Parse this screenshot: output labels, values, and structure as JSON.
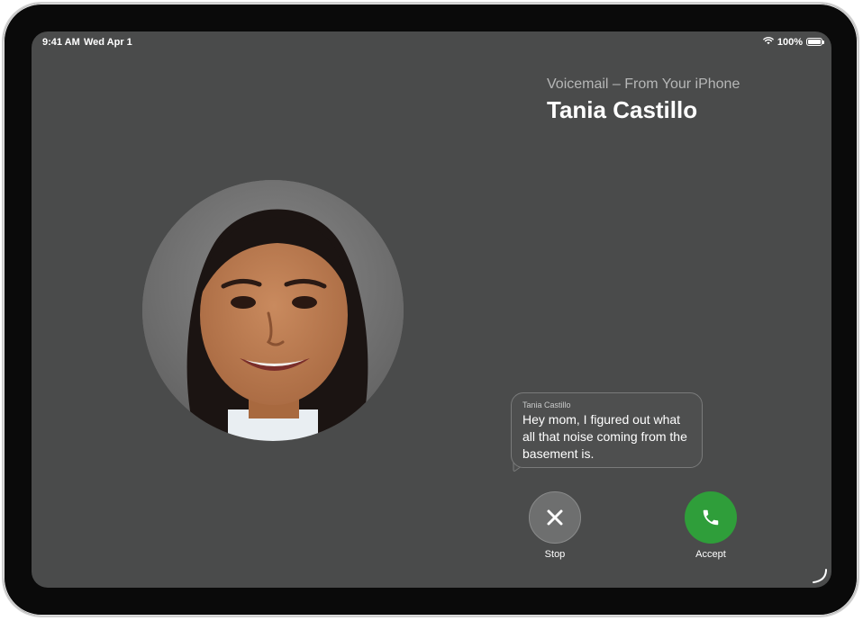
{
  "status_bar": {
    "time": "9:41 AM",
    "date": "Wed Apr 1",
    "battery_percent": "100%",
    "battery_level": 1.0,
    "icons": [
      "wifi-icon",
      "battery-icon"
    ]
  },
  "call": {
    "subtitle": "Voicemail – From Your iPhone",
    "caller_name": "Tania Castillo"
  },
  "transcript": {
    "sender": "Tania Castillo",
    "text": "Hey mom, I figured out what all that noise coming from the basement is."
  },
  "actions": {
    "stop": {
      "label": "Stop",
      "icon": "close-icon"
    },
    "accept": {
      "label": "Accept",
      "icon": "phone-icon"
    }
  },
  "colors": {
    "screen_background": "#4a4b4b",
    "accept_green": "#2f9e3a",
    "stop_gray": "#6e6f6f"
  }
}
